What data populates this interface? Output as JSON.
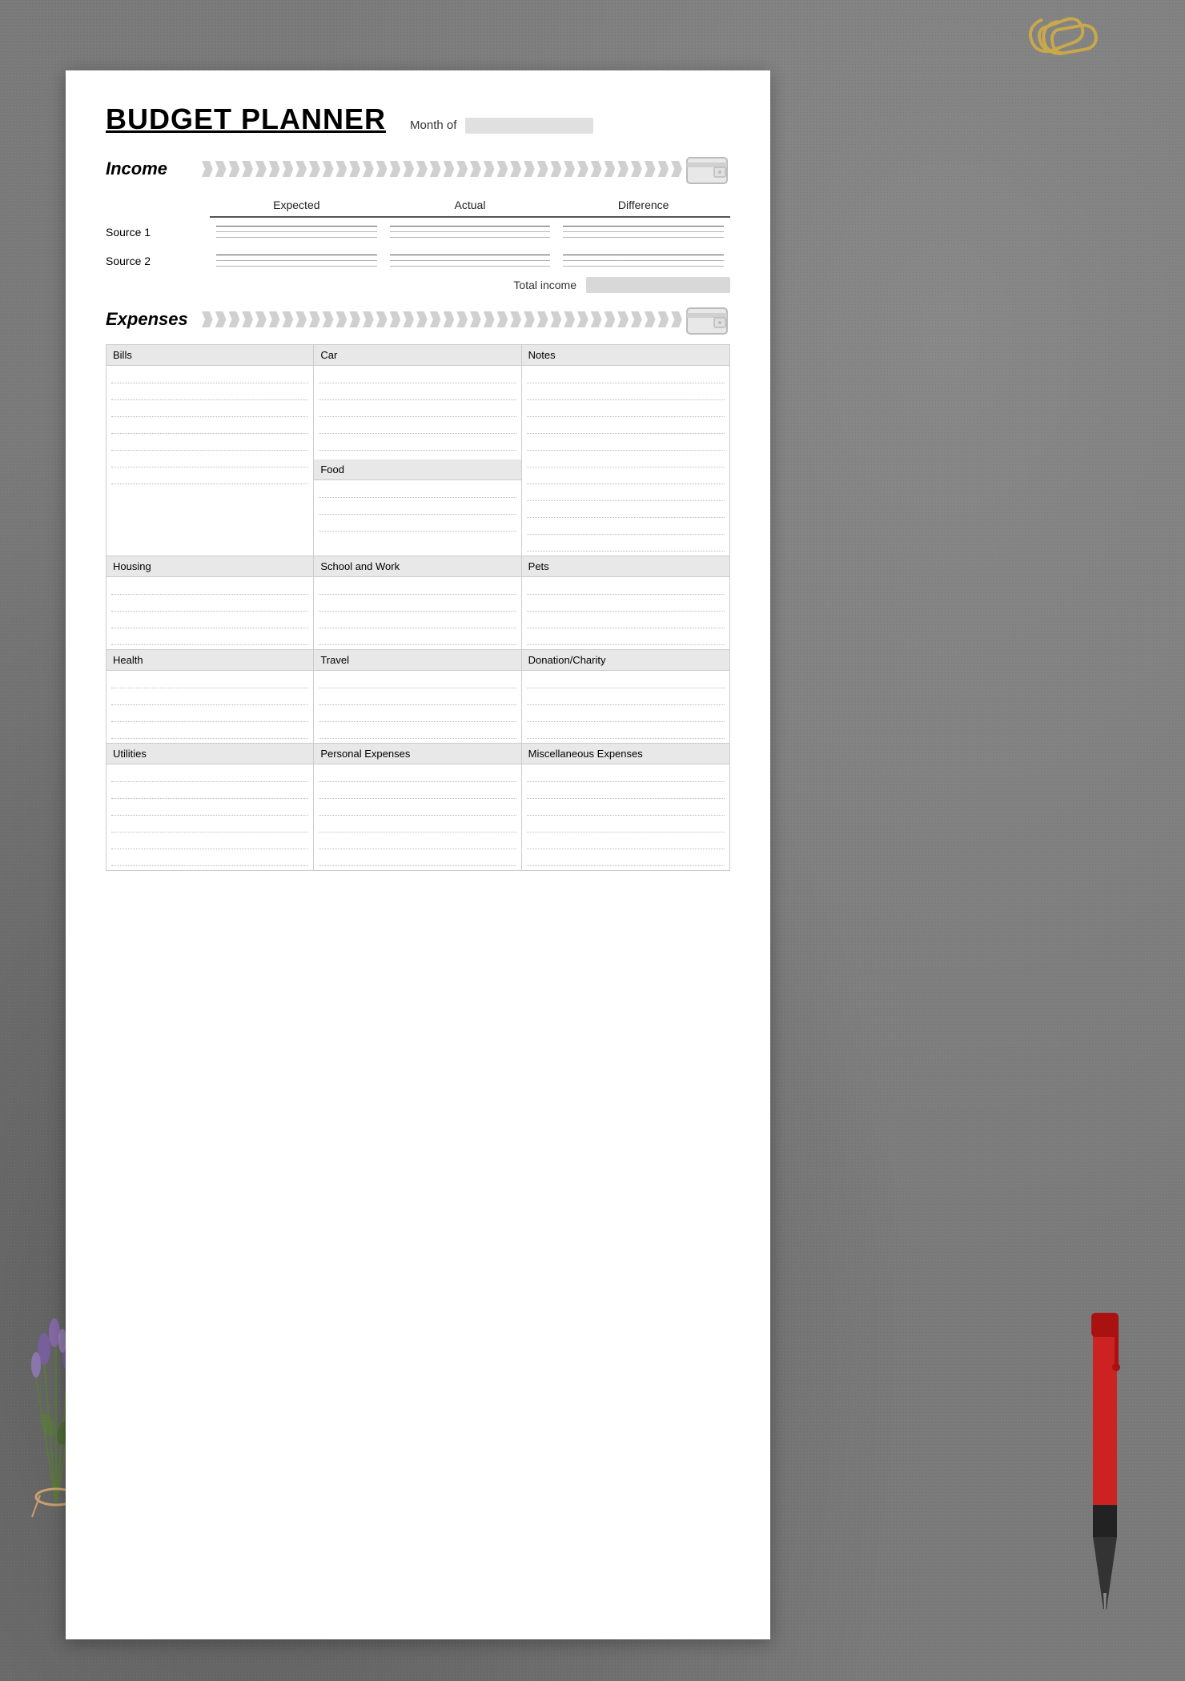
{
  "title": "BUDGET PLANNER",
  "month_of_label": "Month of",
  "income": {
    "label": "Income",
    "columns": [
      "Expected",
      "Actual",
      "Difference"
    ],
    "source1_label": "Source 1",
    "source2_label": "Source 2",
    "total_income_label": "Total income"
  },
  "expenses": {
    "label": "Expenses",
    "categories": [
      {
        "name": "Bills",
        "has_amounts": true
      },
      {
        "name": "Car",
        "has_amounts": false
      },
      {
        "name": "Notes",
        "has_amounts": false
      },
      {
        "name": "Food",
        "has_amounts": false
      },
      {
        "name": "Housing",
        "has_amounts": true
      },
      {
        "name": "School and Work",
        "has_amounts": false
      },
      {
        "name": "Pets",
        "has_amounts": false
      },
      {
        "name": "Health",
        "has_amounts": true
      },
      {
        "name": "Travel",
        "has_amounts": false
      },
      {
        "name": "Donation/Charity",
        "has_amounts": false
      },
      {
        "name": "Utilities",
        "has_amounts": true
      },
      {
        "name": "Personal Expenses",
        "has_amounts": false
      },
      {
        "name": "Miscellaneous Expenses",
        "has_amounts": false
      }
    ]
  },
  "icons": {
    "wallet": "💼",
    "paperclip": "📎"
  }
}
